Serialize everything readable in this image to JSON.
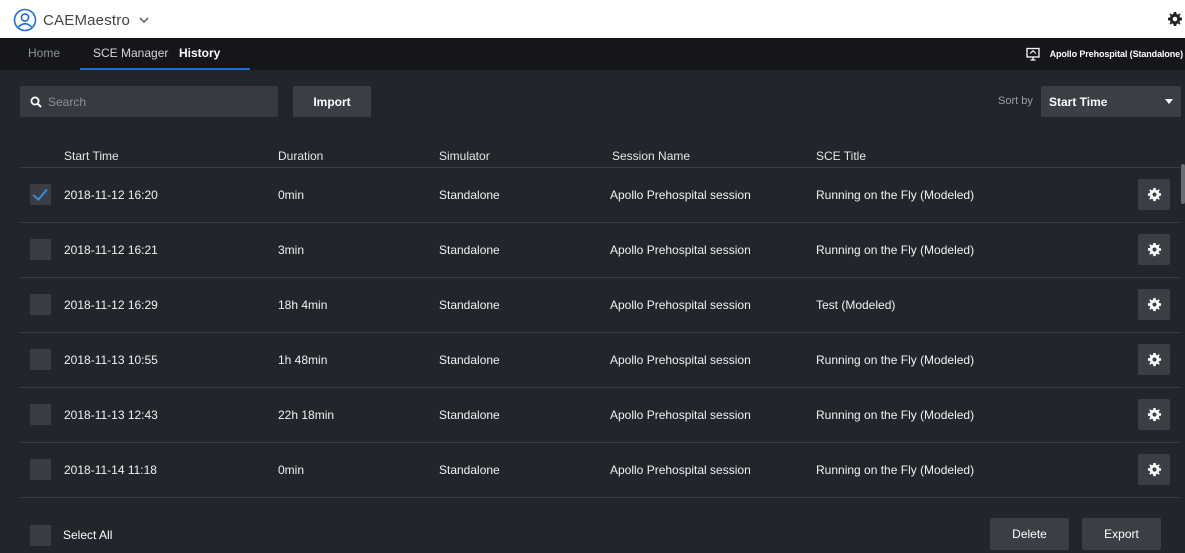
{
  "app": {
    "title": "CAEMaestro"
  },
  "nav": {
    "tabs": [
      {
        "label": "Home",
        "active": false
      },
      {
        "label": "SCE Manager",
        "active": false
      },
      {
        "label": "History",
        "active": true
      }
    ],
    "simulator_label": "Apollo Prehospital (Standalone)"
  },
  "toolbar": {
    "search_placeholder": "Search",
    "import_label": "Import",
    "sort_by_label": "Sort by",
    "sort_value": "Start Time"
  },
  "table": {
    "columns": [
      "Start Time",
      "Duration",
      "Simulator",
      "Session Name",
      "SCE Title"
    ],
    "rows": [
      {
        "checked": true,
        "start_time": "2018-11-12 16:20",
        "duration": "0min",
        "simulator": "Standalone",
        "session_name": "Apollo Prehospital session",
        "sce_title": "Running on the Fly (Modeled)"
      },
      {
        "checked": false,
        "start_time": "2018-11-12 16:21",
        "duration": "3min",
        "simulator": "Standalone",
        "session_name": "Apollo Prehospital session",
        "sce_title": "Running on the Fly (Modeled)"
      },
      {
        "checked": false,
        "start_time": "2018-11-12 16:29",
        "duration": "18h 4min",
        "simulator": "Standalone",
        "session_name": "Apollo Prehospital session",
        "sce_title": "Test (Modeled)"
      },
      {
        "checked": false,
        "start_time": "2018-11-13 10:55",
        "duration": "1h 48min",
        "simulator": "Standalone",
        "session_name": "Apollo Prehospital session",
        "sce_title": "Running on the Fly (Modeled)"
      },
      {
        "checked": false,
        "start_time": "2018-11-13 12:43",
        "duration": "22h 18min",
        "simulator": "Standalone",
        "session_name": "Apollo Prehospital session",
        "sce_title": "Running on the Fly (Modeled)"
      },
      {
        "checked": false,
        "start_time": "2018-11-14 11:18",
        "duration": "0min",
        "simulator": "Standalone",
        "session_name": "Apollo Prehospital session",
        "sce_title": "Running on the Fly (Modeled)"
      }
    ]
  },
  "footer": {
    "select_all_label": "Select All",
    "delete_label": "Delete",
    "export_label": "Export"
  },
  "colors": {
    "background": "#22252b",
    "nav_background": "#141619",
    "accent": "#1d6fd4",
    "checkmark": "#2f8cf0"
  },
  "icons": [
    "user-icon",
    "chevron-down-icon",
    "gear-icon",
    "monitor-icon",
    "search-icon",
    "checkmark-icon"
  ]
}
